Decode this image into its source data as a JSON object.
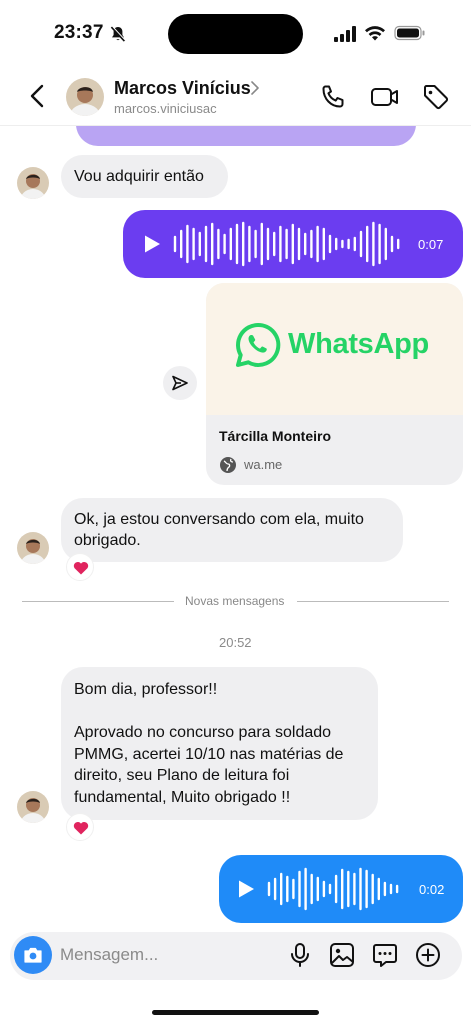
{
  "status_bar": {
    "time": "23:37"
  },
  "header": {
    "contact_name": "Marcos Vinícius",
    "username": "marcos.viniciusac"
  },
  "messages": {
    "msg1": "Vou adquirir então",
    "audio1_duration": "0:07",
    "link_card": {
      "brand": "WhatsApp",
      "title": "Tárcilla Monteiro",
      "domain": "wa.me"
    },
    "msg2_line1": "Ok, ja estou conversando com ela, muito",
    "msg2_line2": "obrigado.",
    "divider": "Novas mensagens",
    "timestamp": "20:52",
    "msg3_lines": [
      "Bom dia, professor!!",
      "Aprovado no concurso para soldado",
      "PMMG, acertei 10/10 nas matérias de",
      "direito, seu Plano de leitura foi",
      "fundamental, Muito obrigado !!"
    ],
    "audio2_duration": "0:02"
  },
  "composer": {
    "placeholder": "Mensagem..."
  },
  "colors": {
    "purple_bubble": "#6b3df0",
    "blue_bubble": "#1f8bf8",
    "incoming_bubble": "#efeff1",
    "whatsapp_green": "#25d366",
    "heart": "#e0245e"
  },
  "icons": {
    "header": [
      "back-icon",
      "chevron-right-icon",
      "phone-icon",
      "video-icon",
      "tag-icon"
    ],
    "composer": [
      "camera-icon",
      "mic-icon",
      "image-icon",
      "sticker-icon",
      "plus-icon"
    ]
  }
}
